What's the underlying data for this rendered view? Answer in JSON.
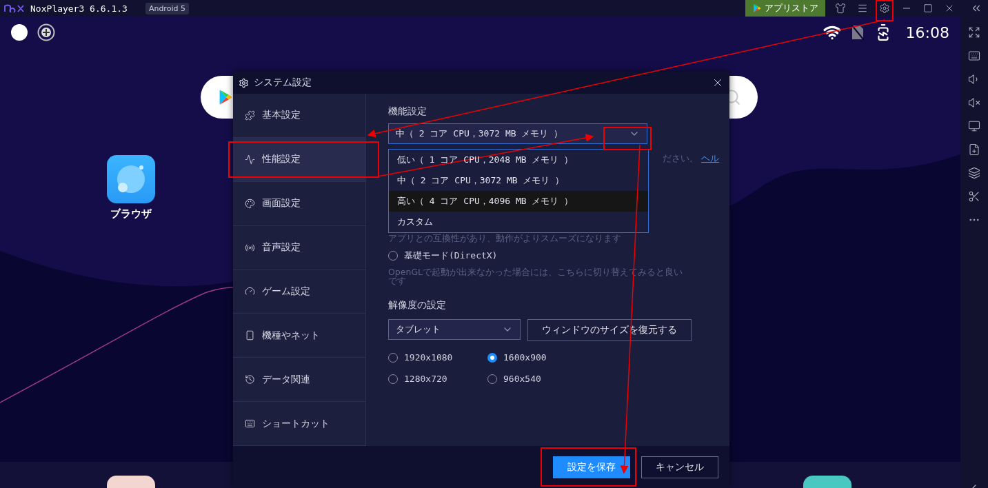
{
  "titlebar": {
    "app_name": "NoxPlayer3 6.6.1.3",
    "badge": "Android 5",
    "store_button": "アプリストア"
  },
  "status_bar": {
    "time": "16:08"
  },
  "home": {
    "apps": [
      {
        "label": "ブラウザ"
      }
    ]
  },
  "dialog": {
    "title": "システム設定",
    "sidebar": [
      {
        "label": "基本設定",
        "selected": false,
        "kind": "puzzle"
      },
      {
        "label": "性能設定",
        "selected": true,
        "kind": "pulse"
      },
      {
        "label": "画面設定",
        "selected": false,
        "kind": "palette"
      },
      {
        "label": "音声設定",
        "selected": false,
        "kind": "sound"
      },
      {
        "label": "ゲーム設定",
        "selected": false,
        "kind": "gauge"
      },
      {
        "label": "機種やネット",
        "selected": false,
        "kind": "device"
      },
      {
        "label": "データ関連",
        "selected": false,
        "kind": "history"
      },
      {
        "label": "ショートカット",
        "selected": false,
        "kind": "keyboard"
      }
    ],
    "performance": {
      "heading": "機能設定",
      "value": "中（ 2 コア CPU，3072 MB メモリ ）",
      "options": [
        {
          "label": "低い（ 1 コア CPU，2048 MB メモリ ）",
          "highlighted": false
        },
        {
          "label": "中（ 2 コア CPU，3072 MB メモリ ）",
          "highlighted": false
        },
        {
          "label": "高い（ 4 コア CPU，4096 MB メモリ ）",
          "highlighted": true
        },
        {
          "label": "カスタム",
          "highlighted": false
        }
      ],
      "hint": "ださい。",
      "hint_link": "ヘル"
    },
    "render": {
      "note_1": "アプリとの互換性があり、動作がよりスムーズになります",
      "modes": [
        {
          "label": "基礎モード(DirectX)",
          "selected": false
        }
      ],
      "note_2": "OpenGLで起動が出来なかった場合には、こちらに切り替えてみると良いです"
    },
    "resolution": {
      "heading": "解像度の設定",
      "preset": "タブレット",
      "restore_button": "ウィンドウのサイズを復元する",
      "options": [
        {
          "label": "1920x1080",
          "selected": false
        },
        {
          "label": "1600x900",
          "selected": true
        },
        {
          "label": "1280x720",
          "selected": false
        },
        {
          "label": "960x540",
          "selected": false
        }
      ]
    },
    "footer": {
      "save": "設定を保存",
      "cancel": "キャンセル"
    }
  }
}
